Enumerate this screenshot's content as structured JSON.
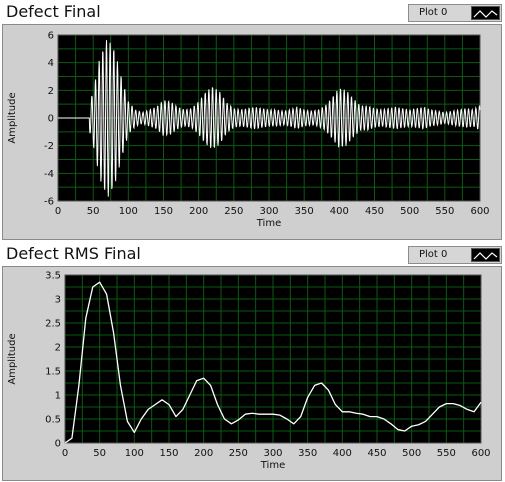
{
  "charts": [
    {
      "title": "Defect Final",
      "legend_label": "Plot 0",
      "chart_data": {
        "type": "line",
        "title": "Defect Final",
        "xlabel": "Time",
        "ylabel": "Amplitude",
        "xlim": [
          0,
          600
        ],
        "ylim": [
          -6,
          6
        ],
        "xticks": [
          0,
          50,
          100,
          150,
          200,
          250,
          300,
          350,
          400,
          450,
          500,
          550,
          600
        ],
        "yticks": [
          -6,
          -4,
          -2,
          0,
          2,
          4,
          6
        ],
        "grid": true,
        "legend": "top-right",
        "series": [
          {
            "name": "Plot 0",
            "sampling": "oscillation envelope sampled every 10 time units (peak amplitude of the oscillating waveform)",
            "x": [
              0,
              10,
              20,
              30,
              40,
              50,
              60,
              70,
              80,
              90,
              100,
              110,
              120,
              130,
              140,
              150,
              160,
              170,
              180,
              190,
              200,
              210,
              220,
              230,
              240,
              250,
              260,
              270,
              280,
              290,
              300,
              310,
              320,
              330,
              340,
              350,
              360,
              370,
              380,
              390,
              400,
              410,
              420,
              430,
              440,
              450,
              460,
              470,
              480,
              490,
              500,
              510,
              520,
              530,
              540,
              550,
              560,
              570,
              580,
              590,
              600
            ],
            "amplitude": [
              0,
              0,
              0,
              0,
              0,
              2.0,
              4.5,
              5.8,
              5.0,
              3.0,
              1.2,
              0.6,
              0.4,
              0.6,
              0.8,
              1.3,
              1.2,
              0.8,
              0.6,
              0.7,
              1.2,
              1.9,
              2.3,
              1.9,
              1.1,
              0.7,
              0.6,
              0.7,
              0.8,
              0.7,
              0.6,
              0.6,
              0.5,
              0.6,
              0.8,
              0.6,
              0.5,
              0.6,
              0.9,
              1.5,
              2.2,
              2.0,
              1.4,
              0.9,
              0.9,
              0.7,
              0.6,
              0.7,
              0.8,
              0.7,
              0.6,
              0.7,
              0.8,
              0.6,
              0.5,
              0.4,
              0.5,
              0.6,
              0.7,
              0.6,
              0.9
            ]
          }
        ]
      }
    },
    {
      "title": "Defect RMS Final",
      "legend_label": "Plot 0",
      "chart_data": {
        "type": "line",
        "title": "Defect RMS Final",
        "xlabel": "Time",
        "ylabel": "Amplitude",
        "xlim": [
          0,
          600
        ],
        "ylim": [
          0,
          3.5
        ],
        "xticks": [
          0,
          50,
          100,
          150,
          200,
          250,
          300,
          350,
          400,
          450,
          500,
          550,
          600
        ],
        "yticks": [
          0,
          0.5,
          1,
          1.5,
          2,
          2.5,
          3,
          3.5
        ],
        "grid": true,
        "legend": "top-right",
        "series": [
          {
            "name": "Plot 0",
            "x": [
              0,
              10,
              20,
              30,
              40,
              50,
              60,
              70,
              80,
              90,
              100,
              110,
              120,
              130,
              140,
              150,
              160,
              170,
              180,
              190,
              200,
              210,
              220,
              230,
              240,
              250,
              260,
              270,
              280,
              290,
              300,
              310,
              320,
              330,
              340,
              350,
              360,
              370,
              380,
              390,
              400,
              410,
              420,
              430,
              440,
              450,
              460,
              470,
              480,
              490,
              500,
              510,
              520,
              530,
              540,
              550,
              560,
              570,
              580,
              590,
              600
            ],
            "y": [
              0,
              0.1,
              1.2,
              2.6,
              3.25,
              3.35,
              3.1,
              2.3,
              1.2,
              0.45,
              0.22,
              0.5,
              0.7,
              0.8,
              0.9,
              0.8,
              0.55,
              0.7,
              1.0,
              1.3,
              1.35,
              1.2,
              0.8,
              0.5,
              0.4,
              0.48,
              0.6,
              0.62,
              0.6,
              0.6,
              0.6,
              0.58,
              0.5,
              0.4,
              0.55,
              0.95,
              1.2,
              1.25,
              1.1,
              0.8,
              0.65,
              0.65,
              0.62,
              0.6,
              0.55,
              0.55,
              0.5,
              0.4,
              0.28,
              0.25,
              0.35,
              0.38,
              0.45,
              0.6,
              0.75,
              0.82,
              0.82,
              0.78,
              0.7,
              0.65,
              0.85
            ]
          }
        ]
      }
    }
  ]
}
